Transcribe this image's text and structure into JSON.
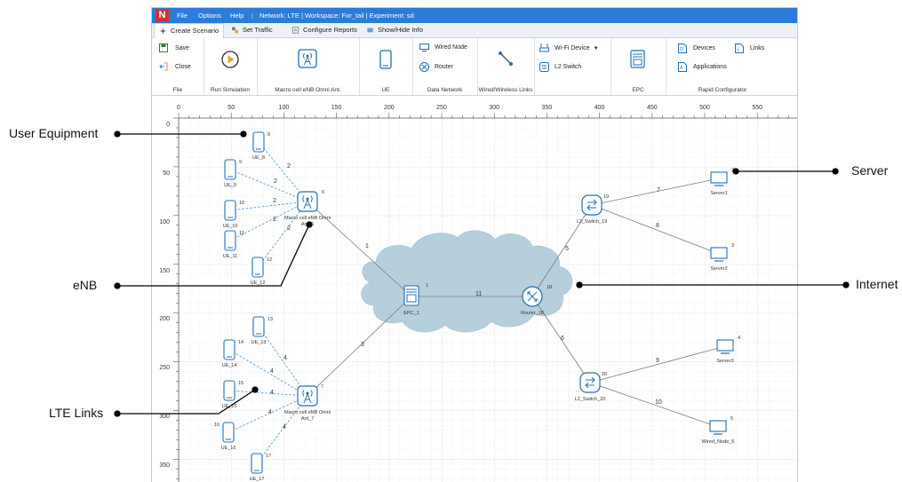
{
  "titlebar": {
    "menus": [
      "File",
      "Options",
      "Help"
    ],
    "title": "Network: LTE | Workspace: For_tail | Experiment: sd",
    "logo": "N"
  },
  "tabs": [
    "Create Scenario",
    "Set Traffic",
    "Configure Reports",
    "Show/Hide Info"
  ],
  "ribbon": {
    "file_save": "Save",
    "file_close": "Close",
    "file_group": "File",
    "run_group": "Run Simulation",
    "enb_group": "Macro cell eNB Omni Ant.",
    "ue_group": "UE",
    "wired_node": "Wired Node",
    "router": "Router",
    "data_group": "Data Network",
    "links_group": "Wired/Wireless Links",
    "wifi": "Wi-Fi Device",
    "l2": "L2 Switch",
    "epc_group": "EPC",
    "devices": "Devices",
    "links": "Links",
    "applications": "Applications",
    "rapid_group": "Rapid Configurator"
  },
  "ruler": {
    "x": [
      "0",
      "50",
      "100",
      "150",
      "200",
      "250",
      "300",
      "350",
      "400",
      "450",
      "500",
      "550"
    ],
    "y": [
      "0",
      "50",
      "100",
      "150",
      "200",
      "250",
      "300",
      "350"
    ]
  },
  "nodes": {
    "ue8": {
      "label": "UE_8",
      "id": "8"
    },
    "ue9": {
      "label": "UE_9",
      "id": "9"
    },
    "ue10": {
      "label": "UE_10",
      "id": "10"
    },
    "ue11": {
      "label": "UE_11",
      "id": "11"
    },
    "ue12": {
      "label": "UE_12",
      "id": "12"
    },
    "ue13": {
      "label": "UE_13",
      "id": "13"
    },
    "ue14": {
      "label": "UE_14",
      "id": "14"
    },
    "ue15": {
      "label": "UE_15",
      "id": "15"
    },
    "ue16": {
      "label": "UE_16",
      "id": "16"
    },
    "ue17": {
      "label": "UE_17",
      "id": "17"
    },
    "enb6": {
      "label1": "Macro cell eNB Omni",
      "label2": "Ant_6",
      "id": "6"
    },
    "enb7": {
      "label1": "Macro cell eNB Omni",
      "label2": "Ant_7",
      "id": "7"
    },
    "epc": {
      "label": "EPC_1",
      "id": "1"
    },
    "router": {
      "label": "Router_18",
      "id": "18"
    },
    "sw19": {
      "label": "L2_Switch_19",
      "id": "19"
    },
    "sw20": {
      "label": "L2_Switch_20",
      "id": "20"
    },
    "server1": {
      "label": "Server1",
      "id": "2"
    },
    "server2": {
      "label": "Server2",
      "id": "3"
    },
    "server3": {
      "label": "Server3",
      "id": "4"
    },
    "wired5": {
      "label": "Wired_Node_5",
      "id": "5"
    }
  },
  "links": {
    "lte_top": "2",
    "lte_bottom": "4",
    "enb6_epc": "1",
    "enb7_epc": "3",
    "epc_router": "11",
    "router_sw19": "5",
    "router_sw20": "6",
    "sw19_s1": "7",
    "sw19_s2": "8",
    "sw20_s3": "9",
    "sw20_w5": "10"
  },
  "callouts": {
    "ue": "User Equipment",
    "enb": "eNB",
    "lte": "LTE Links",
    "server": "Server",
    "internet": "Internet"
  },
  "colors": {
    "titlebar": "#2b7bd8",
    "node_blue": "#1f6fb5",
    "lte_link": "#3a8fd6",
    "cloud": "#b6cfdd",
    "wire": "#7a7a7a"
  }
}
